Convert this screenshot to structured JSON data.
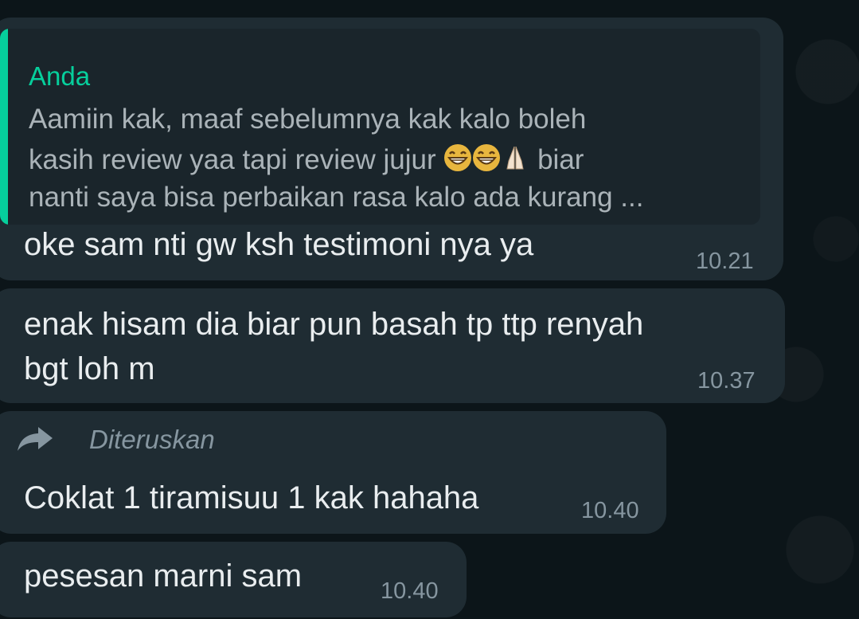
{
  "chat": {
    "messages": [
      {
        "quote": {
          "author": "Anda",
          "line1": "Aamiin kak, maaf sebelumnya kak kalo boleh",
          "line2_before": "kasih review yaa tapi review jujur",
          "line2_after": "biar",
          "line3": "nanti saya bisa perbaikan rasa kalo ada kurang ...",
          "emojis": [
            "grinning-face-with-smiling-eyes",
            "grinning-face-with-smiling-eyes",
            "folded-hands"
          ]
        },
        "text": "oke sam nti gw ksh testimoni nya ya",
        "time": "10.21"
      },
      {
        "text_line1": "enak hisam dia biar pun basah tp ttp renyah",
        "text_line2": "bgt loh m",
        "time": "10.37"
      },
      {
        "forwarded_label": "Diteruskan",
        "text": "Coklat 1 tiramisuu 1 kak hahaha",
        "time": "10.40"
      },
      {
        "text": "pesesan marni sam",
        "time": "10.40"
      }
    ],
    "colors": {
      "bubble": "#1f2c33",
      "quote_accent": "#06cf9c",
      "text": "#e9edef",
      "meta": "#8696a0"
    }
  }
}
